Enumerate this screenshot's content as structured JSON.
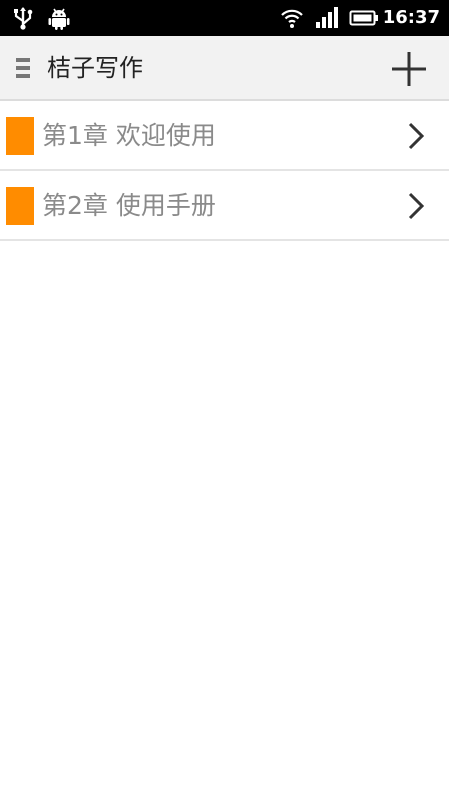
{
  "status_bar": {
    "time": "16:37",
    "icons": [
      "usb-icon",
      "android-debug-icon",
      "wifi-icon",
      "signal-icon",
      "battery-icon"
    ]
  },
  "app_bar": {
    "title": "桔子写作",
    "menu_icon": "hamburger-menu-icon",
    "add_icon": "plus-icon"
  },
  "chapters": [
    {
      "title": "第1章 欢迎使用",
      "marker_color": "#ff8c00"
    },
    {
      "title": "第2章 使用手册",
      "marker_color": "#ff8c00"
    }
  ],
  "colors": {
    "accent": "#ff8c00",
    "status_bar_bg": "#000000",
    "app_bar_bg": "#f2f2f2",
    "chapter_text": "#8a8a8a"
  }
}
